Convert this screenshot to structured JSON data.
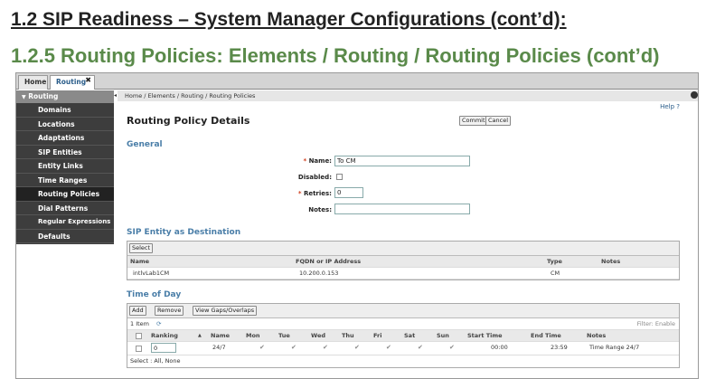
{
  "slide": {
    "title1": "1.2 SIP Readiness – System Manager Configurations (cont’d):",
    "title2": "1.2.5 Routing Policies: Elements / Routing / Routing Policies (cont’d)"
  },
  "tabs": [
    {
      "label": "Home"
    },
    {
      "label": "Routing"
    }
  ],
  "sidebar": {
    "header": "Routing",
    "items": [
      {
        "label": "Domains"
      },
      {
        "label": "Locations"
      },
      {
        "label": "Adaptations"
      },
      {
        "label": "SIP Entities"
      },
      {
        "label": "Entity Links"
      },
      {
        "label": "Time Ranges"
      },
      {
        "label": "Routing Policies"
      },
      {
        "label": "Dial Patterns"
      },
      {
        "label": "Regular Expressions"
      },
      {
        "label": "Defaults"
      }
    ]
  },
  "breadcrumb": "Home / Elements / Routing / Routing Policies",
  "help": "Help ?",
  "page_title": "Routing Policy Details",
  "buttons": {
    "commit": "Commit",
    "cancel": "Cancel"
  },
  "general": {
    "title": "General",
    "name_label": "Name:",
    "name_value": "To CM",
    "disabled_label": "Disabled:",
    "retries_label": "Retries:",
    "retries_value": "0",
    "notes_label": "Notes:",
    "notes_value": ""
  },
  "sip_entity": {
    "title": "SIP Entity as Destination",
    "select_label": "Select",
    "columns": [
      "Name",
      "FQDN or IP Address",
      "Type",
      "Notes"
    ],
    "rows": [
      {
        "name": "intlvLab1CM",
        "fqdn": "10.200.0.153",
        "type": "CM",
        "notes": ""
      }
    ]
  },
  "time_of_day": {
    "title": "Time of Day",
    "add_label": "Add",
    "remove_label": "Remove",
    "gaps_label": "View Gaps/Overlaps",
    "count": "1 Item",
    "filter": "Filter: Enable",
    "columns": [
      "Ranking",
      "Name",
      "Mon",
      "Tue",
      "Wed",
      "Thu",
      "Fri",
      "Sat",
      "Sun",
      "Start Time",
      "End Time",
      "Notes"
    ],
    "rows": [
      {
        "ranking": "0",
        "name": "24/7",
        "start": "00:00",
        "end": "23:59",
        "notes": "Time Range 24/7"
      }
    ],
    "footer": "Select : All, None"
  }
}
